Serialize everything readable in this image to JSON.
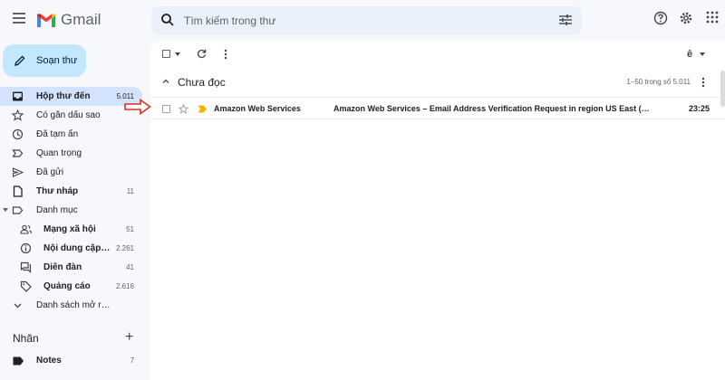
{
  "app": {
    "name": "Gmail"
  },
  "search": {
    "placeholder": "Tìm kiếm trong thư"
  },
  "sidebar": {
    "compose_label": "Soạn thư",
    "items": [
      {
        "label": "Hộp thư đến",
        "count": "5.011",
        "icon": "inbox-icon"
      },
      {
        "label": "Có gắn dấu sao",
        "count": "",
        "icon": "star-icon"
      },
      {
        "label": "Đã tạm ẩn",
        "count": "",
        "icon": "clock-icon"
      },
      {
        "label": "Quan trọng",
        "count": "",
        "icon": "important-icon"
      },
      {
        "label": "Đã gửi",
        "count": "",
        "icon": "send-icon"
      },
      {
        "label": "Thư nháp",
        "count": "11",
        "icon": "draft-icon"
      },
      {
        "label": "Danh mục",
        "count": "",
        "icon": "label-icon"
      },
      {
        "label": "Mạng xã hội",
        "count": "51",
        "icon": "people-icon"
      },
      {
        "label": "Nội dung cập nhật",
        "count": "2.261",
        "icon": "info-icon"
      },
      {
        "label": "Diễn đàn",
        "count": "41",
        "icon": "forum-icon"
      },
      {
        "label": "Quảng cáo",
        "count": "2.616",
        "icon": "tag-icon"
      },
      {
        "label": "Danh sách mở rộng",
        "count": "",
        "icon": "chevron-down-icon"
      }
    ],
    "labels_header": "Nhãn",
    "labels_add": "+",
    "notes": {
      "label": "Notes",
      "count": "7"
    }
  },
  "toolbar": {
    "sort_icon": "ê"
  },
  "section": {
    "title": "Chưa đọc",
    "range": "1–50 trong số 5.011"
  },
  "emails": [
    {
      "sender": "Amazon Web Services",
      "subject": "Amazon Web Services – Email Address Verification Request in region US East (N. Virginia)",
      "time": "23:25"
    }
  ],
  "colors": {
    "accent": "#0b57d0",
    "active": "#d3e3fd",
    "compose": "#c2e7ff",
    "annotation": "#d93025",
    "important": "#f4b400"
  }
}
